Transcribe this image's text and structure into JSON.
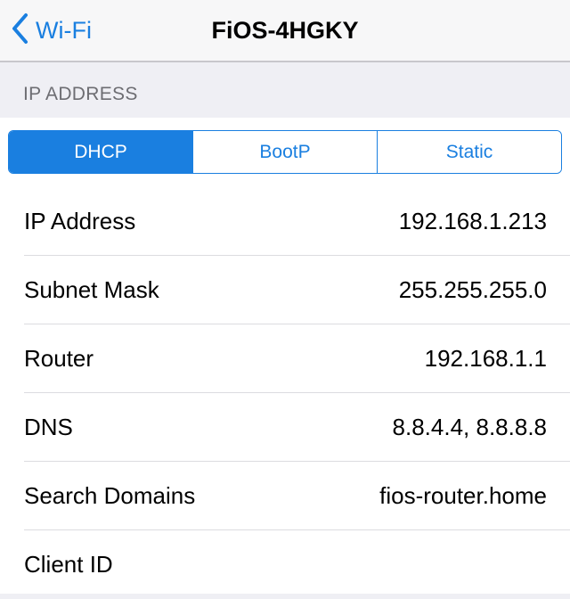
{
  "navbar": {
    "back_icon": "chevron-left-icon",
    "back_label": "Wi-Fi",
    "title": "FiOS-4HGKY"
  },
  "section": {
    "header": "IP ADDRESS"
  },
  "segmented_control": {
    "options": [
      {
        "label": "DHCP",
        "selected": true
      },
      {
        "label": "BootP",
        "selected": false
      },
      {
        "label": "Static",
        "selected": false
      }
    ]
  },
  "rows": [
    {
      "label": "IP Address",
      "value": "192.168.1.213"
    },
    {
      "label": "Subnet Mask",
      "value": "255.255.255.0"
    },
    {
      "label": "Router",
      "value": "192.168.1.1"
    },
    {
      "label": "DNS",
      "value": "8.8.4.4, 8.8.8.8"
    },
    {
      "label": "Search Domains",
      "value": "fios-router.home"
    },
    {
      "label": "Client ID",
      "value": ""
    }
  ],
  "colors": {
    "accent": "#1a7fe0",
    "background": "#efeff4",
    "section_text": "#6d6d72"
  }
}
